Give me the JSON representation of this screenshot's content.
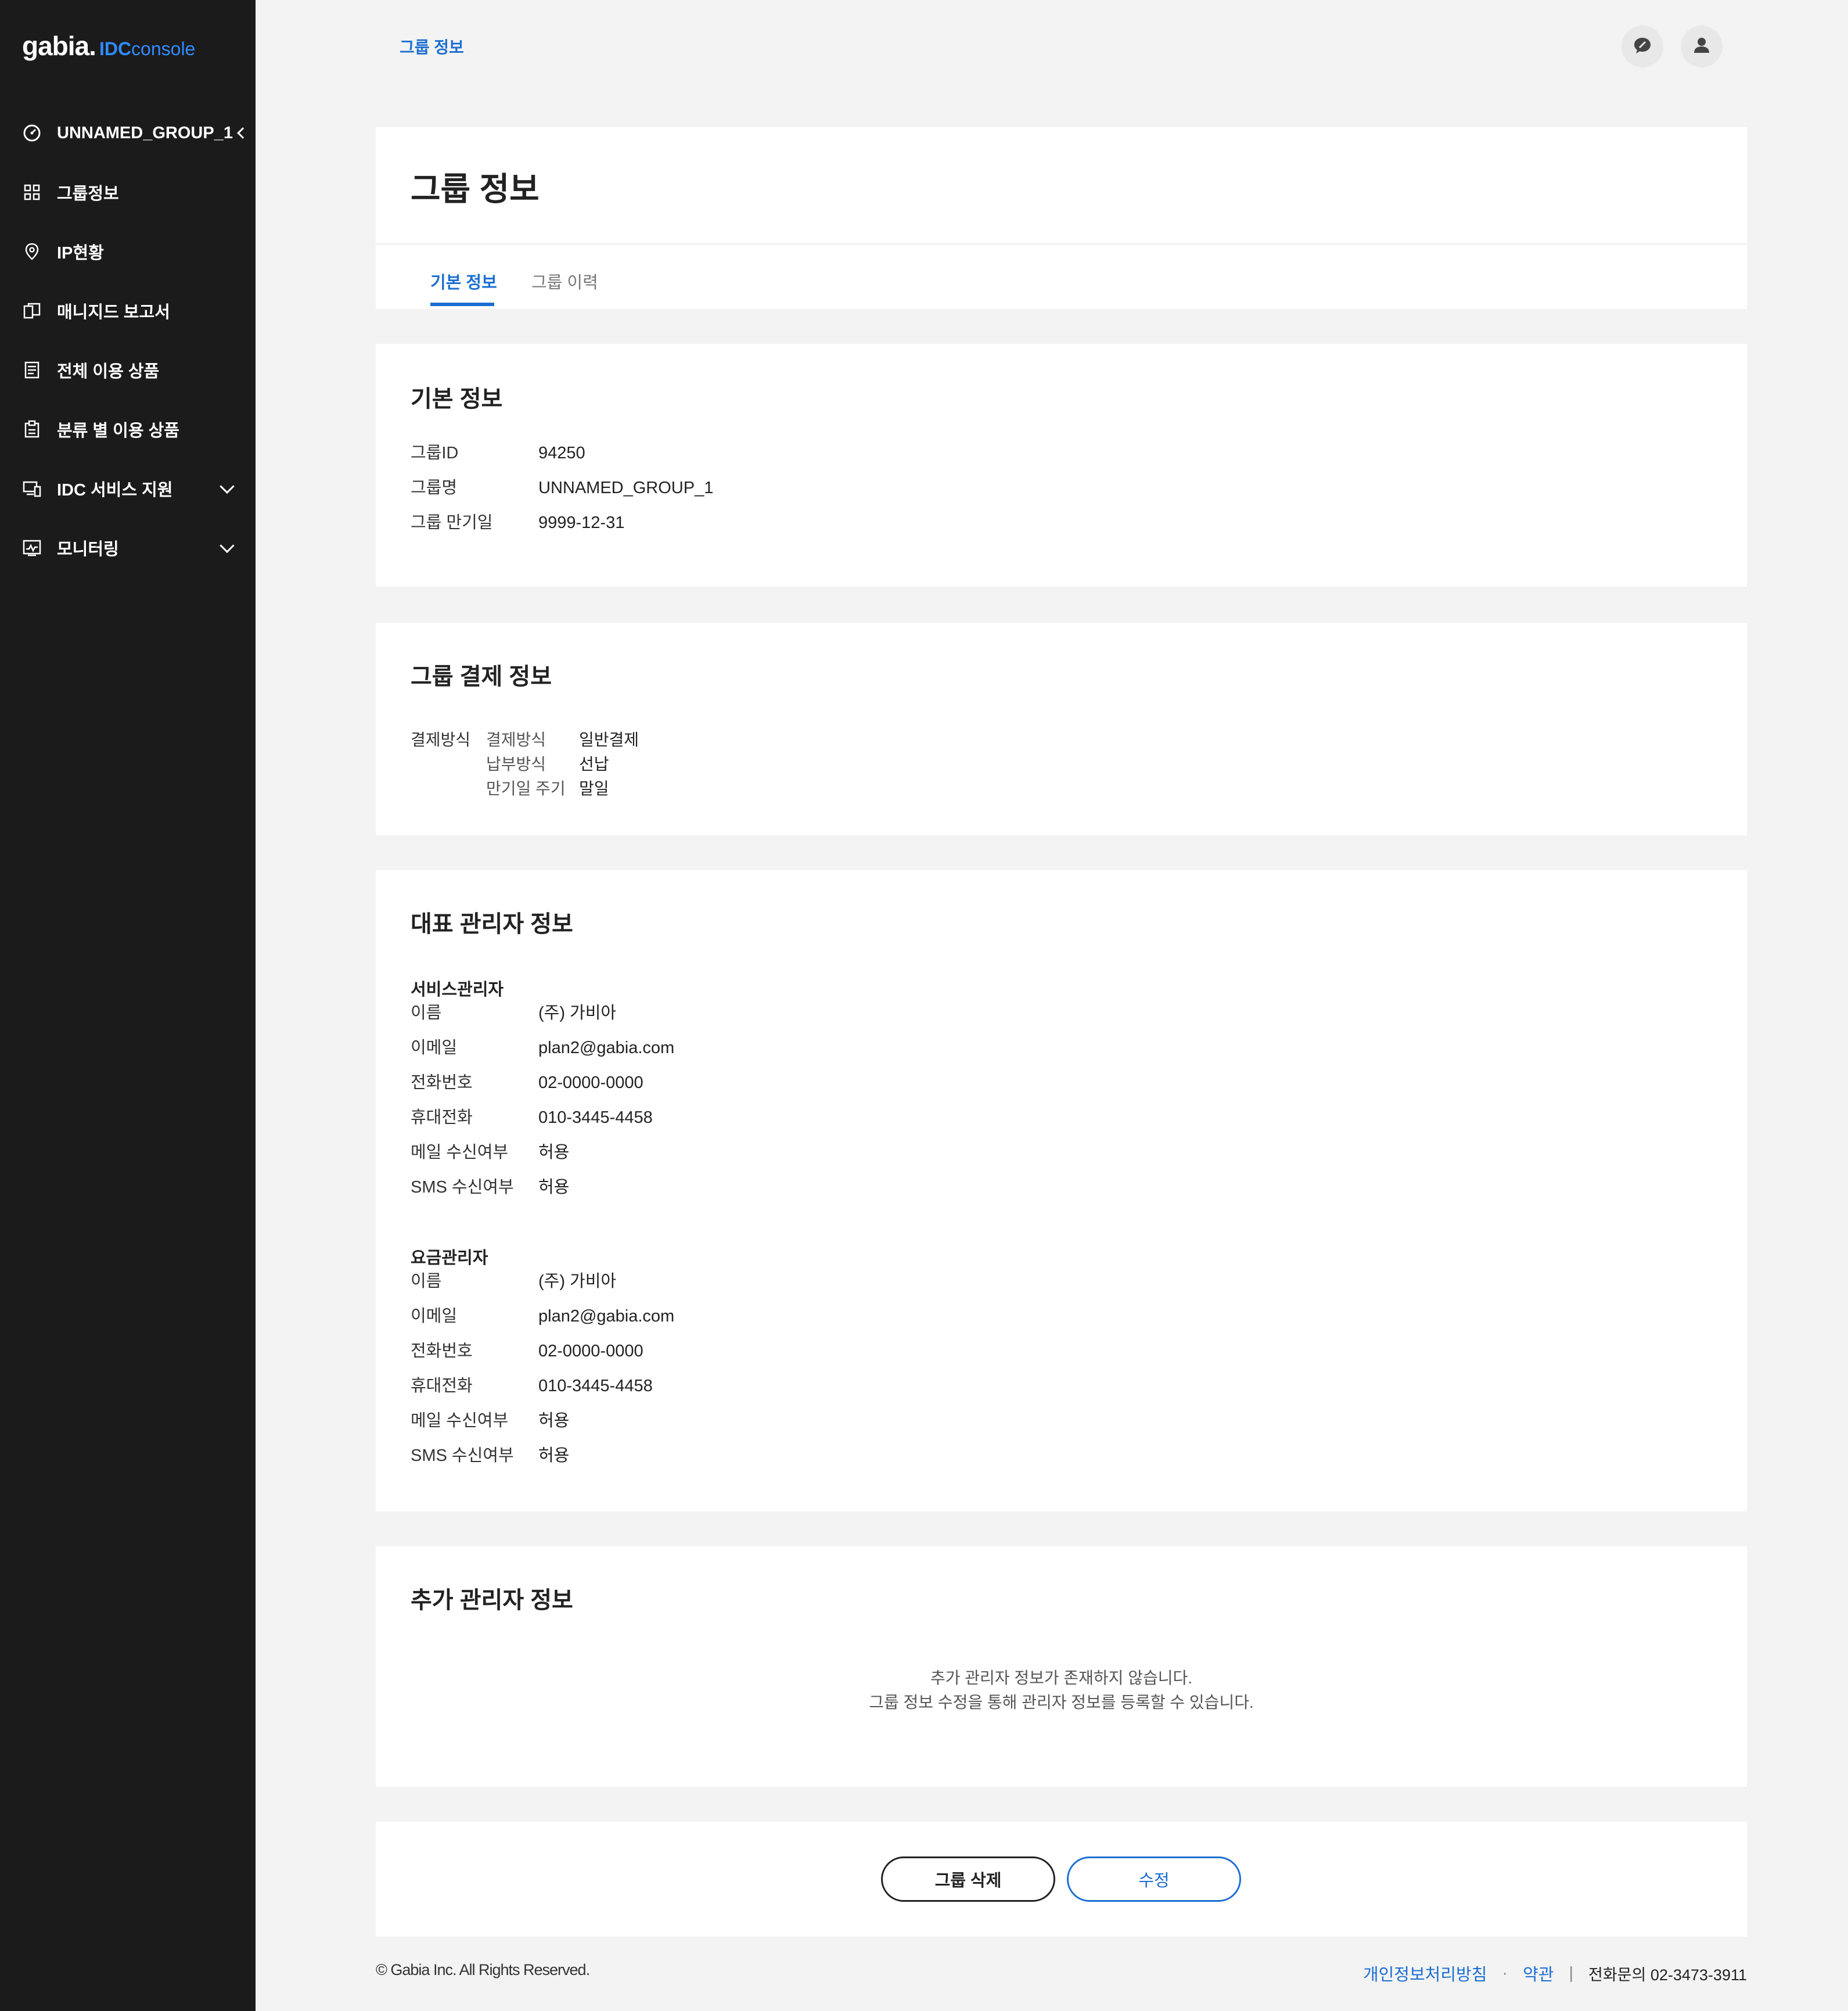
{
  "sidebar": {
    "logo": {
      "brand": "gabia.",
      "idc": "IDC",
      "console": "console"
    },
    "items": [
      {
        "label": "UNNAMED_GROUP_1",
        "icon": "dashboard-icon"
      },
      {
        "label": "그룹정보",
        "icon": "grid-icon"
      },
      {
        "label": "IP현황",
        "icon": "location-pin-icon"
      },
      {
        "label": "매니지드 보고서",
        "icon": "report-icon"
      },
      {
        "label": "전체 이용 상품",
        "icon": "list-doc-icon"
      },
      {
        "label": "분류 별 이용 상품",
        "icon": "clipboard-icon"
      },
      {
        "label": "IDC 서비스 지원",
        "icon": "devices-icon"
      },
      {
        "label": "모니터링",
        "icon": "monitor-chart-icon"
      }
    ]
  },
  "header": {
    "breadcrumb": "그룹 정보"
  },
  "page": {
    "title": "그룹 정보",
    "tabs": [
      {
        "label": "기본 정보",
        "active": true
      },
      {
        "label": "그룹 이력",
        "active": false
      }
    ]
  },
  "basic_info": {
    "title": "기본 정보",
    "rows": [
      {
        "label": "그룹ID",
        "value": "94250"
      },
      {
        "label": "그룹명",
        "value": "UNNAMED_GROUP_1"
      },
      {
        "label": "그룹 만기일",
        "value": "9999-12-31"
      }
    ]
  },
  "payment_info": {
    "title": "그룹 결제 정보",
    "label": "결제방식",
    "rows": [
      {
        "key": "결제방식",
        "value": "일반결제"
      },
      {
        "key": "납부방식",
        "value": "선납"
      },
      {
        "key": "만기일 주기",
        "value": "말일"
      }
    ]
  },
  "admin_info": {
    "title": "대표 관리자 정보",
    "service_admin": {
      "title": "서비스관리자",
      "rows": [
        {
          "label": "이름",
          "value": "(주) 가비아"
        },
        {
          "label": "이메일",
          "value": "plan2@gabia.com"
        },
        {
          "label": "전화번호",
          "value": "02-0000-0000"
        },
        {
          "label": "휴대전화",
          "value": "010-3445-4458"
        },
        {
          "label": "메일 수신여부",
          "value": "허용"
        },
        {
          "label": "SMS 수신여부",
          "value": "허용"
        }
      ]
    },
    "billing_admin": {
      "title": "요금관리자",
      "rows": [
        {
          "label": "이름",
          "value": "(주) 가비아"
        },
        {
          "label": "이메일",
          "value": "plan2@gabia.com"
        },
        {
          "label": "전화번호",
          "value": "02-0000-0000"
        },
        {
          "label": "휴대전화",
          "value": "010-3445-4458"
        },
        {
          "label": "메일 수신여부",
          "value": "허용"
        },
        {
          "label": "SMS 수신여부",
          "value": "허용"
        }
      ]
    }
  },
  "extra_admin": {
    "title": "추가 관리자 정보",
    "empty_line1": "추가 관리자 정보가 존재하지 않습니다.",
    "empty_line2": "그룹 정보 수정을 통해 관리자 정보를 등록할 수 있습니다."
  },
  "actions": {
    "delete_label": "그룹 삭제",
    "edit_label": "수정"
  },
  "footer": {
    "copyright": "© Gabia Inc. All Rights Reserved.",
    "privacy": "개인정보처리방침",
    "dot": "·",
    "terms": "약관",
    "bar": "|",
    "phone": "전화문의 02-3473-3911"
  },
  "colors": {
    "accent": "#1c6fd1",
    "sidebar_bg": "#1b1b1b",
    "page_bg": "#f3f3f3"
  }
}
